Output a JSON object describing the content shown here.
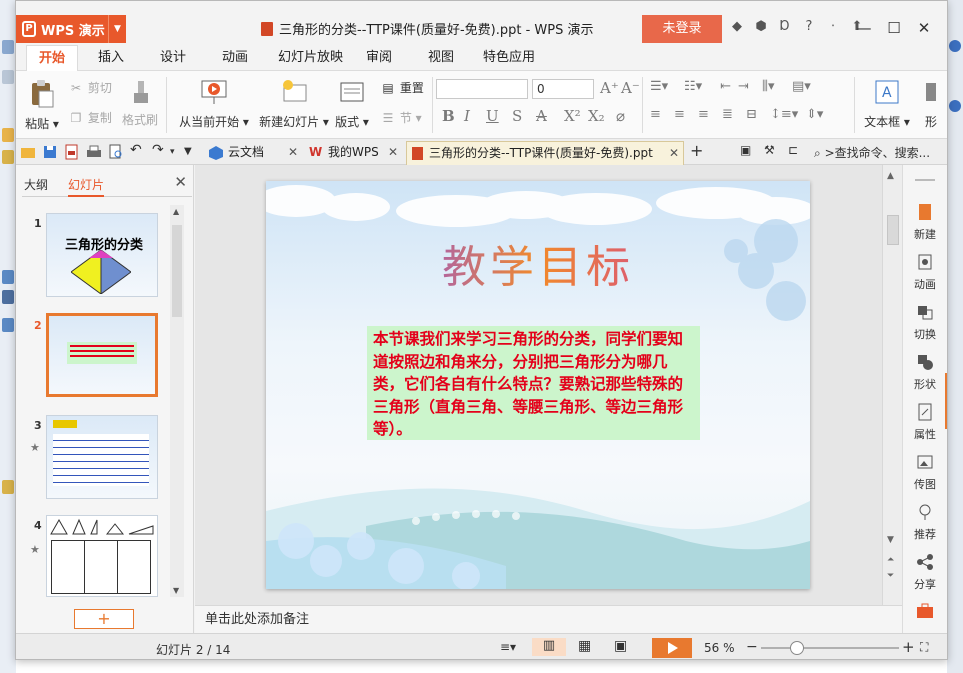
{
  "app": {
    "name": "WPS 演示",
    "doc_title": "三角形的分类--TTP课件(质量好-免费).ppt - WPS 演示",
    "login": "未登录"
  },
  "menu": {
    "tabs": [
      "开始",
      "插入",
      "设计",
      "动画",
      "幻灯片放映",
      "审阅",
      "视图",
      "特色应用"
    ],
    "active": "开始"
  },
  "ribbon": {
    "paste": "粘贴",
    "cut": "剪切",
    "copy": "复制",
    "format_painter": "格式刷",
    "from_current": "从当前开始",
    "new_slide": "新建幻灯片",
    "layout": "版式",
    "reset": "重置",
    "section": "节",
    "font_size": "0",
    "textbox": "文本框",
    "shape": "形"
  },
  "doc_tabs": {
    "cloud": "云文档",
    "mywps": "我的WPS",
    "current": "三角形的分类--TTP课件(质量好-免费).ppt",
    "search": ">查找命令、搜索..."
  },
  "left_panel": {
    "tab_outline": "大纲",
    "tab_slides": "幻灯片",
    "thumbs": [
      {
        "num": "1",
        "title": "三角形的分类"
      },
      {
        "num": "2"
      },
      {
        "num": "3"
      },
      {
        "num": "4"
      }
    ]
  },
  "slide": {
    "title": "教学目标",
    "body": "本节课我们来学习三角形的分类，同学们要知道按照边和角来分，分别把三角形分为哪几类，它们各自有什么特点？要熟记那些特殊的三角形（直角三角、等腰三角形、等边三角形等）。"
  },
  "notes_placeholder": "单击此处添加备注",
  "right_sidebar": [
    "新建",
    "动画",
    "切换",
    "形状",
    "属性",
    "传图",
    "推荐",
    "分享"
  ],
  "status": {
    "slide_counter": "幻灯片 2 / 14",
    "zoom": "56 %"
  },
  "colors": {
    "accent": "#e8582b",
    "body_text": "#e4001a",
    "body_box": "#ccf5cc"
  }
}
